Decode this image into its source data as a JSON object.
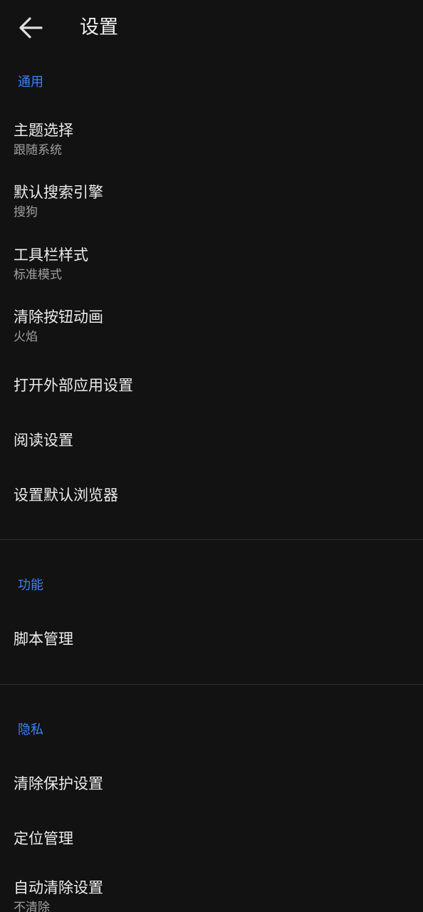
{
  "header": {
    "title": "设置"
  },
  "sections": {
    "general": {
      "label": "通用",
      "items": [
        {
          "title": "主题选择",
          "subtitle": "跟随系统"
        },
        {
          "title": "默认搜索引擎",
          "subtitle": "搜狗"
        },
        {
          "title": "工具栏样式",
          "subtitle": "标准模式"
        },
        {
          "title": "清除按钮动画",
          "subtitle": "火焰"
        },
        {
          "title": "打开外部应用设置"
        },
        {
          "title": "阅读设置"
        },
        {
          "title": "设置默认浏览器"
        }
      ]
    },
    "features": {
      "label": "功能",
      "items": [
        {
          "title": "脚本管理"
        }
      ]
    },
    "privacy": {
      "label": "隐私",
      "items": [
        {
          "title": "清除保护设置"
        },
        {
          "title": "定位管理"
        },
        {
          "title": "自动清除设置",
          "subtitle": "不清除"
        }
      ]
    }
  },
  "colors": {
    "background": "#121212",
    "section_header": "#3b82f6",
    "primary_text": "#ececec",
    "secondary_text": "#a0a0a0",
    "divider": "#2e2e2e"
  }
}
